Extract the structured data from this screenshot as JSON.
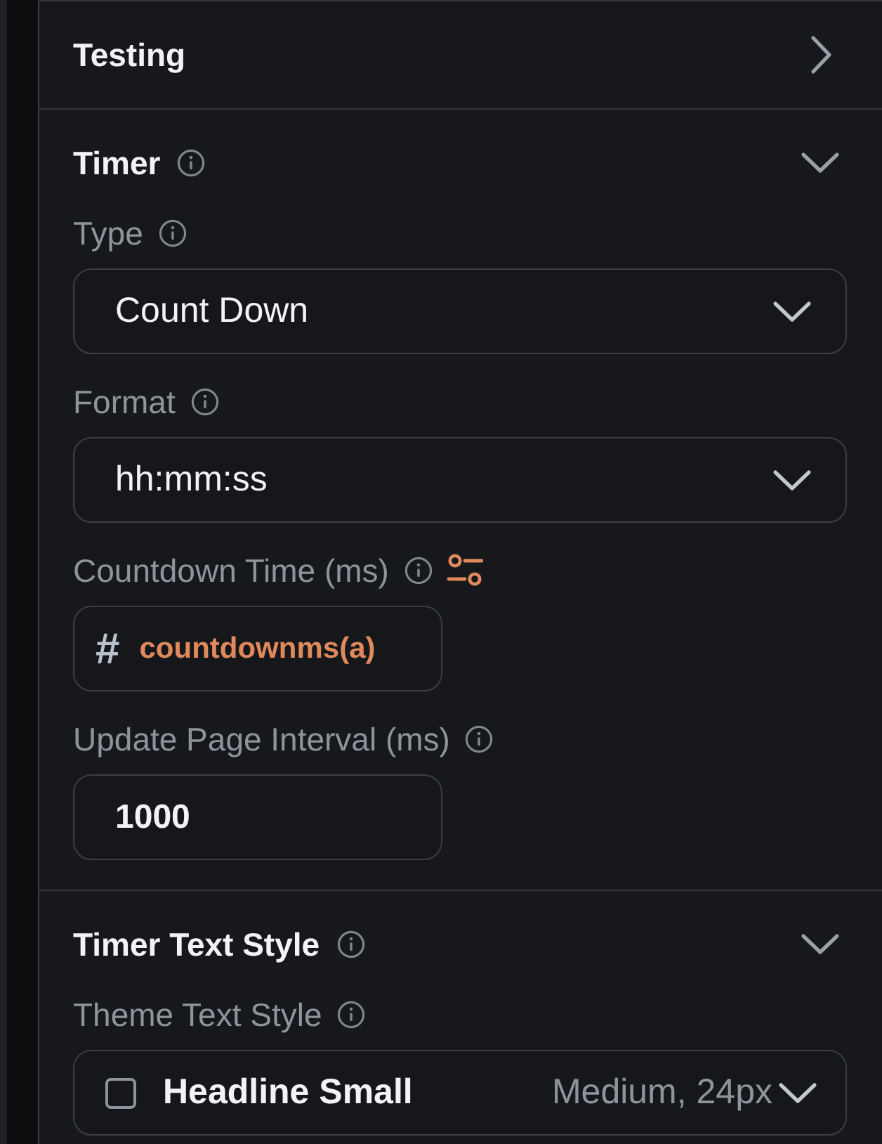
{
  "sections": [
    {
      "title": "Testing",
      "info": false,
      "expanded": false
    },
    {
      "title": "Timer",
      "info": true,
      "expanded": true,
      "fields": [
        {
          "kind": "dropdown",
          "label": "Type",
          "info": true,
          "bound": false,
          "value": "Count Down"
        },
        {
          "kind": "dropdown",
          "label": "Format",
          "info": true,
          "bound": false,
          "value": "hh:mm:ss"
        },
        {
          "kind": "variable",
          "label": "Countdown Time (ms)",
          "info": true,
          "bound": true,
          "symbol": "#",
          "value": "countdownms(a)"
        },
        {
          "kind": "number",
          "label": "Update Page Interval (ms)",
          "info": true,
          "bound": false,
          "value": "1000"
        }
      ]
    },
    {
      "title": "Timer Text Style",
      "info": true,
      "expanded": true,
      "fields": [
        {
          "kind": "text-style",
          "label": "Theme Text Style",
          "info": true,
          "bound": false,
          "checked": false,
          "value": "Headline Small",
          "detail": "Medium, 24px"
        }
      ]
    }
  ]
}
